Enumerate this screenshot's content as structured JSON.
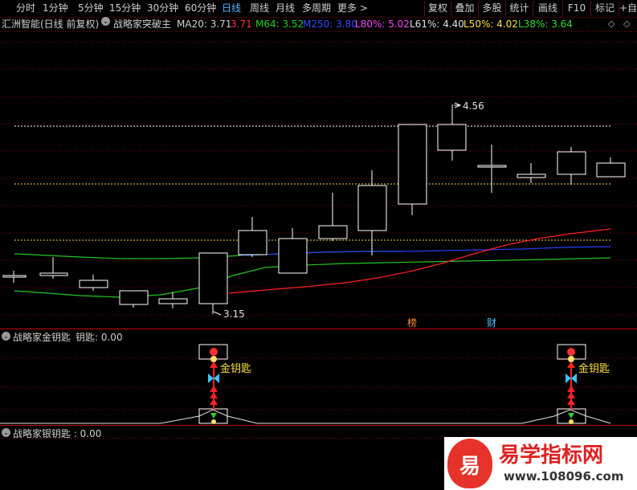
{
  "toolbar": {
    "tabs": [
      "分时",
      "1分钟",
      "5分钟",
      "15分钟",
      "30分钟",
      "60分钟",
      "日线",
      "周线",
      "月线",
      "多周期",
      "更多 >"
    ],
    "active_tab": "日线",
    "right_buttons": [
      "复权",
      "叠加",
      "多股",
      "统计",
      "画线",
      "F10",
      "标记",
      "+自"
    ]
  },
  "info_bar": {
    "stock": "汇洲智能(日线 前复权)",
    "indicator": "战略家突破主",
    "ma20": "MA20: 3.71",
    "val2": "3.71",
    "m64": "M64: 3.52",
    "m250": "M250: 3.80",
    "l80": "L80%: 5.02",
    "l61": "L61%: 4.40",
    "l50": "L50%: 4.02",
    "l38": "L38%: 3.64"
  },
  "price_labels": {
    "high": "4.56",
    "low": "3.15"
  },
  "badges": {
    "bang": "榜",
    "cai": "财"
  },
  "panel2": {
    "title": "战略家金钥匙",
    "sub_label": "钥匙: 0.00",
    "marker_text": "金钥匙"
  },
  "panel3": {
    "title": "战略家银钥匙 : 0.00"
  },
  "watermark": {
    "name": "易学指标网",
    "url": "www.108096.com",
    "glyph": "易"
  },
  "colors": {
    "up": "#ffffff",
    "ma_green": "#22c422",
    "ma_blue": "#2a3cf0",
    "ma_red": "#ff2020",
    "dash_white": "#ffffff",
    "dash_yellow": "#ffd34a",
    "grid": "#9a0000"
  }
}
